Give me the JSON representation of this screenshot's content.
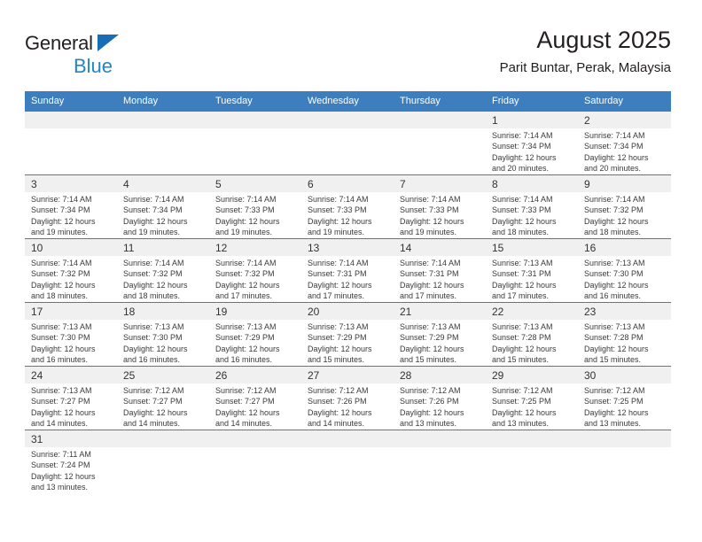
{
  "logo": {
    "word1": "General",
    "word2": "Blue",
    "triangle_color": "#1a6cb5",
    "word2_color": "#2484c6"
  },
  "header": {
    "title": "August 2025",
    "subtitle": "Parit Buntar, Perak, Malaysia"
  },
  "theme": {
    "header_blue": "#3d7ebf",
    "daynum_band": "#f0f0f0",
    "rule_blue": "#3d7ebf"
  },
  "calendar": {
    "weekday_headers": [
      "Sunday",
      "Monday",
      "Tuesday",
      "Wednesday",
      "Thursday",
      "Friday",
      "Saturday"
    ],
    "weeks": [
      [
        {
          "day": "",
          "lines": []
        },
        {
          "day": "",
          "lines": []
        },
        {
          "day": "",
          "lines": []
        },
        {
          "day": "",
          "lines": []
        },
        {
          "day": "",
          "lines": []
        },
        {
          "day": "1",
          "lines": [
            "Sunrise: 7:14 AM",
            "Sunset: 7:34 PM",
            "Daylight: 12 hours",
            "and 20 minutes."
          ]
        },
        {
          "day": "2",
          "lines": [
            "Sunrise: 7:14 AM",
            "Sunset: 7:34 PM",
            "Daylight: 12 hours",
            "and 20 minutes."
          ]
        }
      ],
      [
        {
          "day": "3",
          "lines": [
            "Sunrise: 7:14 AM",
            "Sunset: 7:34 PM",
            "Daylight: 12 hours",
            "and 19 minutes."
          ]
        },
        {
          "day": "4",
          "lines": [
            "Sunrise: 7:14 AM",
            "Sunset: 7:34 PM",
            "Daylight: 12 hours",
            "and 19 minutes."
          ]
        },
        {
          "day": "5",
          "lines": [
            "Sunrise: 7:14 AM",
            "Sunset: 7:33 PM",
            "Daylight: 12 hours",
            "and 19 minutes."
          ]
        },
        {
          "day": "6",
          "lines": [
            "Sunrise: 7:14 AM",
            "Sunset: 7:33 PM",
            "Daylight: 12 hours",
            "and 19 minutes."
          ]
        },
        {
          "day": "7",
          "lines": [
            "Sunrise: 7:14 AM",
            "Sunset: 7:33 PM",
            "Daylight: 12 hours",
            "and 19 minutes."
          ]
        },
        {
          "day": "8",
          "lines": [
            "Sunrise: 7:14 AM",
            "Sunset: 7:33 PM",
            "Daylight: 12 hours",
            "and 18 minutes."
          ]
        },
        {
          "day": "9",
          "lines": [
            "Sunrise: 7:14 AM",
            "Sunset: 7:32 PM",
            "Daylight: 12 hours",
            "and 18 minutes."
          ]
        }
      ],
      [
        {
          "day": "10",
          "lines": [
            "Sunrise: 7:14 AM",
            "Sunset: 7:32 PM",
            "Daylight: 12 hours",
            "and 18 minutes."
          ]
        },
        {
          "day": "11",
          "lines": [
            "Sunrise: 7:14 AM",
            "Sunset: 7:32 PM",
            "Daylight: 12 hours",
            "and 18 minutes."
          ]
        },
        {
          "day": "12",
          "lines": [
            "Sunrise: 7:14 AM",
            "Sunset: 7:32 PM",
            "Daylight: 12 hours",
            "and 17 minutes."
          ]
        },
        {
          "day": "13",
          "lines": [
            "Sunrise: 7:14 AM",
            "Sunset: 7:31 PM",
            "Daylight: 12 hours",
            "and 17 minutes."
          ]
        },
        {
          "day": "14",
          "lines": [
            "Sunrise: 7:14 AM",
            "Sunset: 7:31 PM",
            "Daylight: 12 hours",
            "and 17 minutes."
          ]
        },
        {
          "day": "15",
          "lines": [
            "Sunrise: 7:13 AM",
            "Sunset: 7:31 PM",
            "Daylight: 12 hours",
            "and 17 minutes."
          ]
        },
        {
          "day": "16",
          "lines": [
            "Sunrise: 7:13 AM",
            "Sunset: 7:30 PM",
            "Daylight: 12 hours",
            "and 16 minutes."
          ]
        }
      ],
      [
        {
          "day": "17",
          "lines": [
            "Sunrise: 7:13 AM",
            "Sunset: 7:30 PM",
            "Daylight: 12 hours",
            "and 16 minutes."
          ]
        },
        {
          "day": "18",
          "lines": [
            "Sunrise: 7:13 AM",
            "Sunset: 7:30 PM",
            "Daylight: 12 hours",
            "and 16 minutes."
          ]
        },
        {
          "day": "19",
          "lines": [
            "Sunrise: 7:13 AM",
            "Sunset: 7:29 PM",
            "Daylight: 12 hours",
            "and 16 minutes."
          ]
        },
        {
          "day": "20",
          "lines": [
            "Sunrise: 7:13 AM",
            "Sunset: 7:29 PM",
            "Daylight: 12 hours",
            "and 15 minutes."
          ]
        },
        {
          "day": "21",
          "lines": [
            "Sunrise: 7:13 AM",
            "Sunset: 7:29 PM",
            "Daylight: 12 hours",
            "and 15 minutes."
          ]
        },
        {
          "day": "22",
          "lines": [
            "Sunrise: 7:13 AM",
            "Sunset: 7:28 PM",
            "Daylight: 12 hours",
            "and 15 minutes."
          ]
        },
        {
          "day": "23",
          "lines": [
            "Sunrise: 7:13 AM",
            "Sunset: 7:28 PM",
            "Daylight: 12 hours",
            "and 15 minutes."
          ]
        }
      ],
      [
        {
          "day": "24",
          "lines": [
            "Sunrise: 7:13 AM",
            "Sunset: 7:27 PM",
            "Daylight: 12 hours",
            "and 14 minutes."
          ]
        },
        {
          "day": "25",
          "lines": [
            "Sunrise: 7:12 AM",
            "Sunset: 7:27 PM",
            "Daylight: 12 hours",
            "and 14 minutes."
          ]
        },
        {
          "day": "26",
          "lines": [
            "Sunrise: 7:12 AM",
            "Sunset: 7:27 PM",
            "Daylight: 12 hours",
            "and 14 minutes."
          ]
        },
        {
          "day": "27",
          "lines": [
            "Sunrise: 7:12 AM",
            "Sunset: 7:26 PM",
            "Daylight: 12 hours",
            "and 14 minutes."
          ]
        },
        {
          "day": "28",
          "lines": [
            "Sunrise: 7:12 AM",
            "Sunset: 7:26 PM",
            "Daylight: 12 hours",
            "and 13 minutes."
          ]
        },
        {
          "day": "29",
          "lines": [
            "Sunrise: 7:12 AM",
            "Sunset: 7:25 PM",
            "Daylight: 12 hours",
            "and 13 minutes."
          ]
        },
        {
          "day": "30",
          "lines": [
            "Sunrise: 7:12 AM",
            "Sunset: 7:25 PM",
            "Daylight: 12 hours",
            "and 13 minutes."
          ]
        }
      ],
      [
        {
          "day": "31",
          "lines": [
            "Sunrise: 7:11 AM",
            "Sunset: 7:24 PM",
            "Daylight: 12 hours",
            "and 13 minutes."
          ]
        },
        {
          "day": "",
          "lines": []
        },
        {
          "day": "",
          "lines": []
        },
        {
          "day": "",
          "lines": []
        },
        {
          "day": "",
          "lines": []
        },
        {
          "day": "",
          "lines": []
        },
        {
          "day": "",
          "lines": []
        }
      ]
    ]
  }
}
